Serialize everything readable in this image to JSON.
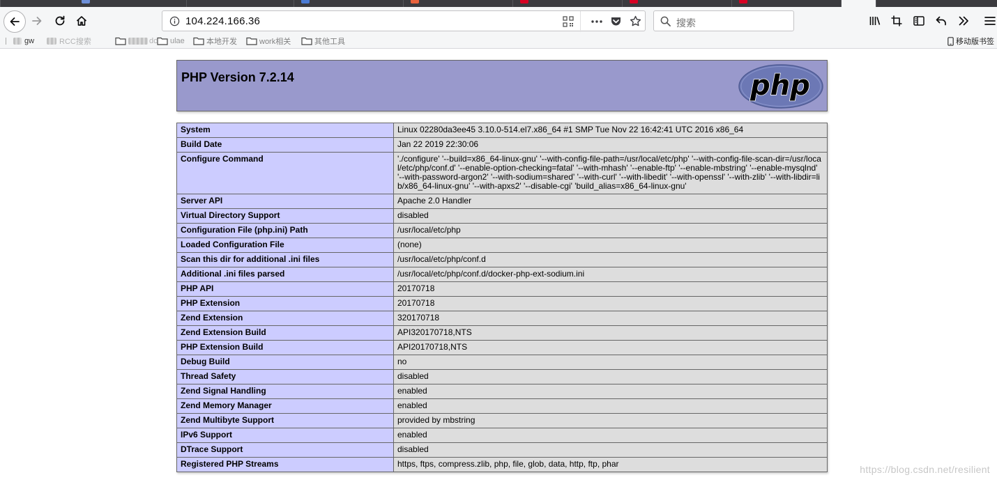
{
  "browser": {
    "url": "104.224.166.36",
    "search_placeholder": "搜索",
    "mobile_bookmarks_label": "移动版书签",
    "bookmarks": [
      {
        "label": "gw"
      },
      {
        "label": "RCC搜索"
      },
      {
        "label": "dc"
      },
      {
        "label": "ulae"
      },
      {
        "label": "本地开发"
      },
      {
        "label": "work相关"
      },
      {
        "label": "其他工具"
      }
    ],
    "tab_colors": [
      "#4a7bd4",
      "#4a7bd4",
      "#4a7bd4",
      "#e9623c",
      "#d70022",
      "#d70022",
      "#d70022",
      "#d70022"
    ]
  },
  "phpinfo": {
    "title": "PHP Version 7.2.14",
    "logo_text": "php",
    "rows": [
      {
        "name": "System",
        "value": "Linux 02280da3ee45 3.10.0-514.el7.x86_64 #1 SMP Tue Nov 22 16:42:41 UTC 2016 x86_64"
      },
      {
        "name": "Build Date",
        "value": "Jan 22 2019 22:30:06"
      },
      {
        "name": "Configure Command",
        "value": "'./configure' '--build=x86_64-linux-gnu' '--with-config-file-path=/usr/local/etc/php' '--with-config-file-scan-dir=/usr/local/etc/php/conf.d' '--enable-option-checking=fatal' '--with-mhash' '--enable-ftp' '--enable-mbstring' '--enable-mysqlnd' '--with-password-argon2' '--with-sodium=shared' '--with-curl' '--with-libedit' '--with-openssl' '--with-zlib' '--with-libdir=lib/x86_64-linux-gnu' '--with-apxs2' '--disable-cgi' 'build_alias=x86_64-linux-gnu'"
      },
      {
        "name": "Server API",
        "value": "Apache 2.0 Handler"
      },
      {
        "name": "Virtual Directory Support",
        "value": "disabled"
      },
      {
        "name": "Configuration File (php.ini) Path",
        "value": "/usr/local/etc/php"
      },
      {
        "name": "Loaded Configuration File",
        "value": "(none)"
      },
      {
        "name": "Scan this dir for additional .ini files",
        "value": "/usr/local/etc/php/conf.d"
      },
      {
        "name": "Additional .ini files parsed",
        "value": "/usr/local/etc/php/conf.d/docker-php-ext-sodium.ini"
      },
      {
        "name": "PHP API",
        "value": "20170718"
      },
      {
        "name": "PHP Extension",
        "value": "20170718"
      },
      {
        "name": "Zend Extension",
        "value": "320170718"
      },
      {
        "name": "Zend Extension Build",
        "value": "API320170718,NTS"
      },
      {
        "name": "PHP Extension Build",
        "value": "API20170718,NTS"
      },
      {
        "name": "Debug Build",
        "value": "no"
      },
      {
        "name": "Thread Safety",
        "value": "disabled"
      },
      {
        "name": "Zend Signal Handling",
        "value": "enabled"
      },
      {
        "name": "Zend Memory Manager",
        "value": "enabled"
      },
      {
        "name": "Zend Multibyte Support",
        "value": "provided by mbstring"
      },
      {
        "name": "IPv6 Support",
        "value": "enabled"
      },
      {
        "name": "DTrace Support",
        "value": "disabled"
      },
      {
        "name": "Registered PHP Streams",
        "value": "https, ftps, compress.zlib, php, file, glob, data, http, ftp, phar"
      }
    ]
  },
  "watermark": "https://blog.csdn.net/resilient"
}
